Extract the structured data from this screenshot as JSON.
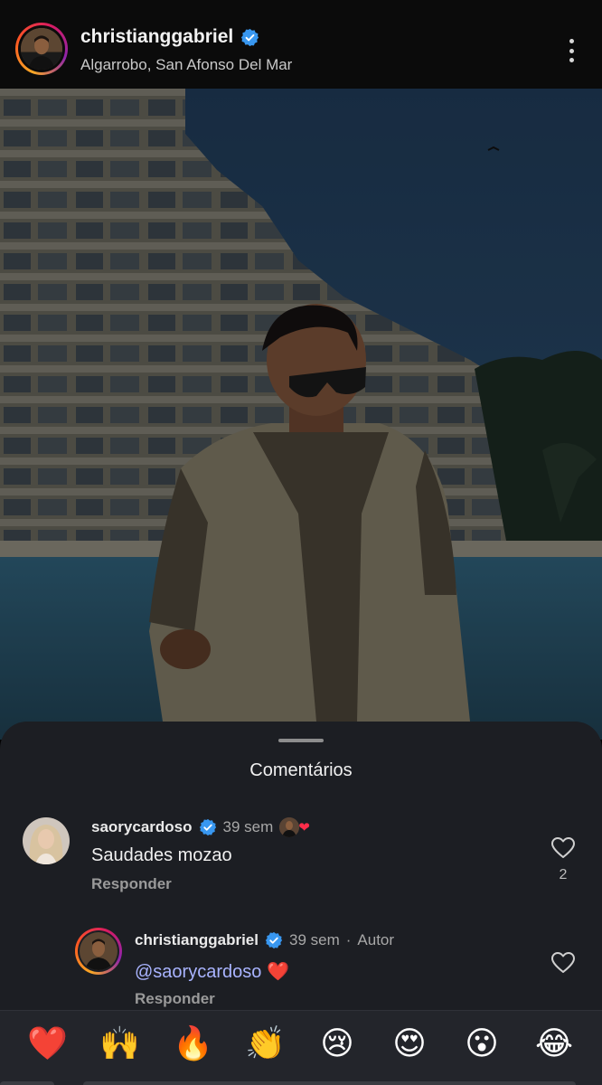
{
  "post": {
    "username": "christianggabriel",
    "location": "Algarrobo, San Afonso Del Mar",
    "verified": true
  },
  "icons": {
    "verified": "verified-badge-icon",
    "more": "more-vertical-icon",
    "like": "heart-outline-icon"
  },
  "colors": {
    "verified": "#3897f0",
    "mention": "#a9b4ff",
    "sheet": "#1c1e23",
    "heart": "#ff2d4a"
  },
  "comments_sheet": {
    "title": "Comentários",
    "comments": [
      {
        "username": "saorycardoso",
        "verified": true,
        "time": "39 sem",
        "liked_by_author": true,
        "text": "Saudades mozao",
        "reply_label": "Responder",
        "like_count": "2"
      }
    ],
    "replies": [
      {
        "username": "christianggabriel",
        "verified": true,
        "time": "39 sem",
        "separator": "·",
        "author_label": "Autor",
        "mention": "@saorycardoso",
        "emoji": "❤️",
        "reply_label": "Responder"
      }
    ]
  },
  "emoji_bar": [
    "❤️",
    "🙌",
    "🔥",
    "👏",
    "😢",
    "😍",
    "😮",
    "😂"
  ]
}
